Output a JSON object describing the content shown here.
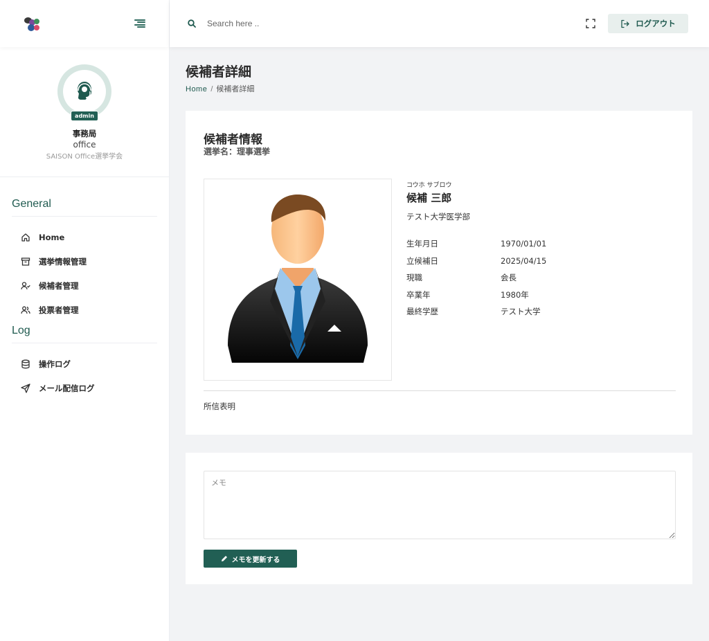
{
  "search": {
    "placeholder": "Search here .."
  },
  "header": {
    "logout_label": "ログアウト"
  },
  "profile": {
    "badge": "admin",
    "name": "事務局",
    "role": "office",
    "org": "SAISON Office選挙学会"
  },
  "nav": {
    "general_heading": "General",
    "general_items": [
      {
        "label": "Home",
        "icon": "home-icon"
      },
      {
        "label": "選挙情報管理",
        "icon": "archive-icon"
      },
      {
        "label": "候補者管理",
        "icon": "user-check-icon"
      },
      {
        "label": "投票者管理",
        "icon": "users-icon"
      }
    ],
    "log_heading": "Log",
    "log_items": [
      {
        "label": "操作ログ",
        "icon": "database-icon"
      },
      {
        "label": "メール配信ログ",
        "icon": "send-icon"
      }
    ]
  },
  "page": {
    "title": "候補者詳細",
    "breadcrumb_home": "Home",
    "breadcrumb_sep": "/",
    "breadcrumb_current": "候補者詳細"
  },
  "candidate": {
    "section_title": "候補者情報",
    "election_label": "選挙名：理事選挙",
    "kana": "コウホ サブロウ",
    "name": "候補 三郎",
    "school": "テスト大学医学部",
    "fields": [
      {
        "label": "生年月日",
        "value": "1970/01/01"
      },
      {
        "label": "立候補日",
        "value": "2025/04/15"
      },
      {
        "label": "現職",
        "value": "会長"
      },
      {
        "label": "卒業年",
        "value": "1980年"
      },
      {
        "label": "最終学歴",
        "value": "テスト大学"
      }
    ],
    "statement": "所信表明"
  },
  "memo": {
    "placeholder": "メモ",
    "button_label": "メモを更新する"
  },
  "colors": {
    "primary": "#215f54",
    "accent_light": "#e8efed",
    "background": "#f2f3f5"
  }
}
